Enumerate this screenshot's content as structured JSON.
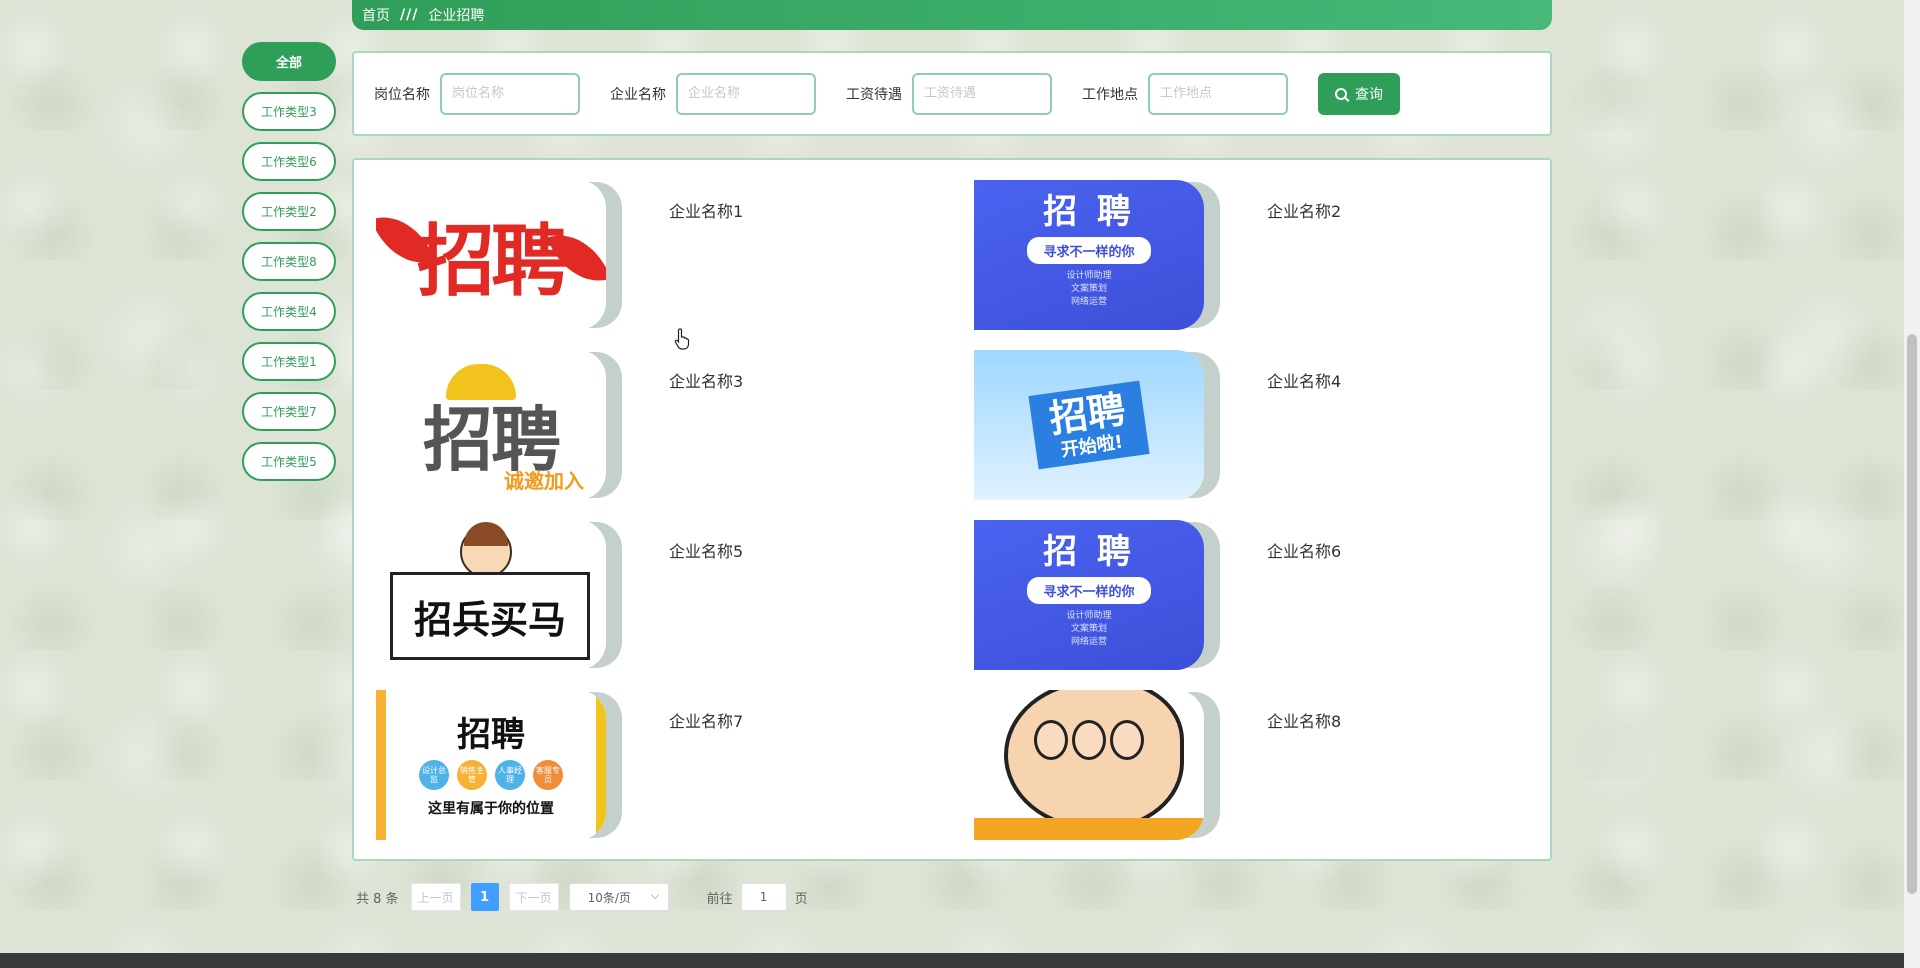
{
  "breadcrumb": {
    "home": "首页",
    "separator": "///",
    "current": "企业招聘"
  },
  "categories": [
    {
      "label": "全部",
      "active": true
    },
    {
      "label": "工作类型3"
    },
    {
      "label": "工作类型6"
    },
    {
      "label": "工作类型2"
    },
    {
      "label": "工作类型8"
    },
    {
      "label": "工作类型4"
    },
    {
      "label": "工作类型1"
    },
    {
      "label": "工作类型7"
    },
    {
      "label": "工作类型5"
    }
  ],
  "search": {
    "fields": [
      {
        "label": "岗位名称",
        "placeholder": "岗位名称",
        "value": ""
      },
      {
        "label": "企业名称",
        "placeholder": "企业名称",
        "value": ""
      },
      {
        "label": "工资待遇",
        "placeholder": "工资待遇",
        "value": ""
      },
      {
        "label": "工作地点",
        "placeholder": "工作地点",
        "value": ""
      }
    ],
    "button_label": "查询"
  },
  "companies": [
    {
      "name": "企业名称1",
      "art": {
        "big": "招聘"
      }
    },
    {
      "name": "企业名称2",
      "art": {
        "top": "招 聘",
        "pill": "寻求不一样的你",
        "sub": [
          "设计师助理",
          "文案策划",
          "网络运营"
        ]
      }
    },
    {
      "name": "企业名称3",
      "art": {
        "big": "招聘",
        "tag": "诚邀加入"
      }
    },
    {
      "name": "企业名称4",
      "art": {
        "big": "招聘",
        "small": "开始啦!"
      }
    },
    {
      "name": "企业名称5",
      "art": {
        "board": "招兵买马"
      }
    },
    {
      "name": "企业名称6",
      "art": {
        "top": "招 聘",
        "pill": "寻求不一样的你",
        "sub": [
          "设计师助理",
          "文案策划",
          "网络运营"
        ]
      }
    },
    {
      "name": "企业名称7",
      "art": {
        "top": "招聘",
        "dots": [
          "设计总监",
          "销售主管",
          "人事经理",
          "客服专员"
        ],
        "line": "这里有属于你的位置"
      }
    },
    {
      "name": "企业名称8",
      "art": {
        "strip": ""
      }
    }
  ],
  "pagination": {
    "total_text": "共 8 条",
    "prev_label": "上一页",
    "current_page": "1",
    "next_label": "下一页",
    "page_size": "10条/页",
    "jump_prefix": "前往",
    "jump_value": "1",
    "jump_suffix": "页"
  },
  "colors": {
    "primary": "#2f9e58",
    "page_active": "#409eff"
  }
}
